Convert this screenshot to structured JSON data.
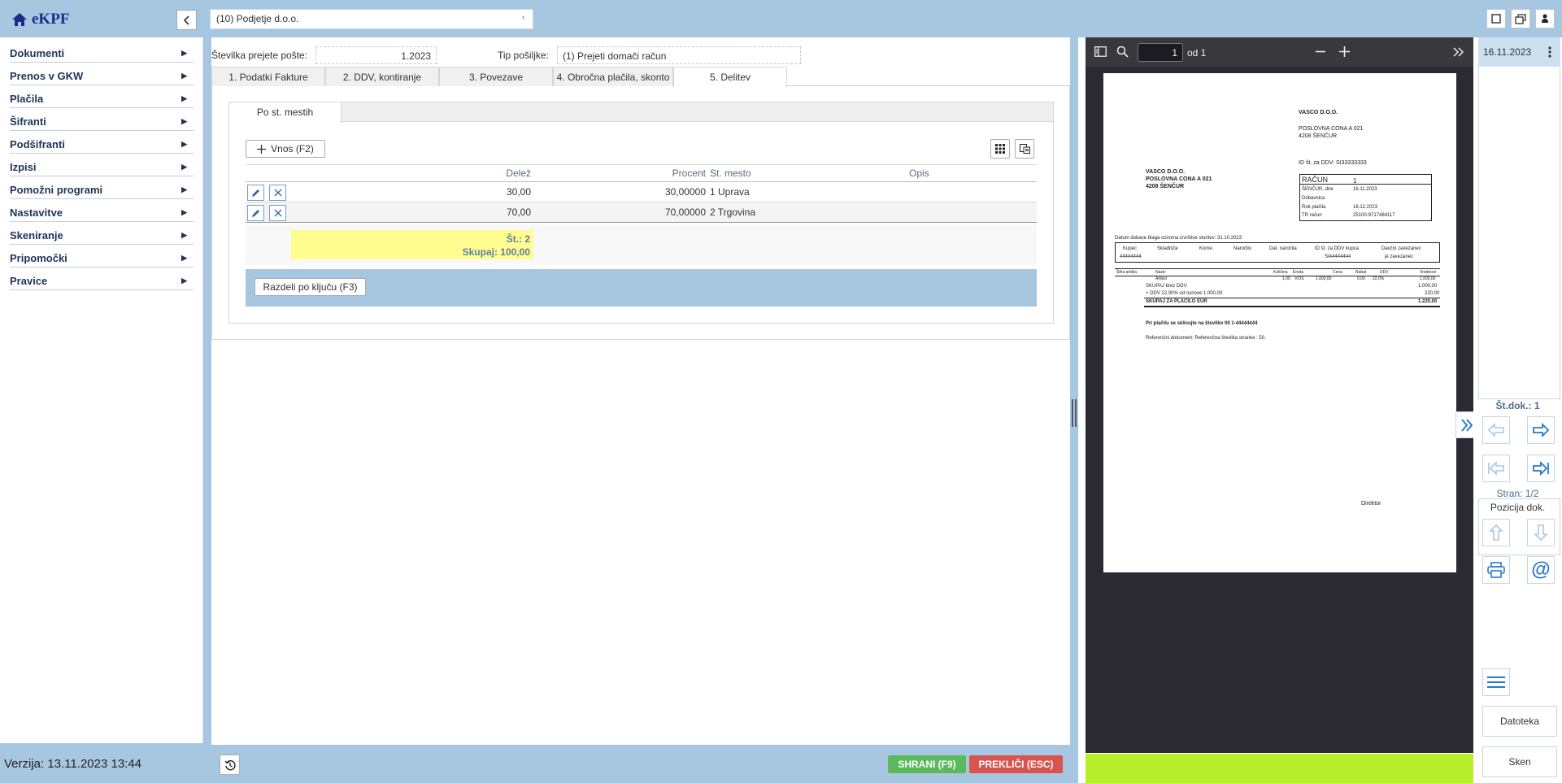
{
  "app": {
    "logo": "eKPF",
    "company": "(10) Podjetje d.o.o."
  },
  "sidebar": {
    "items": [
      {
        "label": "Dokumenti"
      },
      {
        "label": "Prenos v GKW"
      },
      {
        "label": "Plačila"
      },
      {
        "label": "Šifranti"
      },
      {
        "label": "Podšifranti"
      },
      {
        "label": "Izpisi"
      },
      {
        "label": "Pomožni programi"
      },
      {
        "label": "Nastavitve"
      },
      {
        "label": "Skeniranje"
      },
      {
        "label": "Pripomočki"
      },
      {
        "label": "Pravice"
      }
    ],
    "version": "Verzija: 13.11.2023 13:44"
  },
  "form": {
    "mail_no_label": "Številka prejete pošte:",
    "mail_no_value": "1.2023",
    "type_label": "Tip pošiljke:",
    "type_value": "(1) Prejeti domači račun"
  },
  "tabs": [
    {
      "label": "1. Podatki Fakture"
    },
    {
      "label": "2. DDV, kontiranje"
    },
    {
      "label": "3. Povezave"
    },
    {
      "label": "4. Obročna plačila, skonto"
    },
    {
      "label": "5. Delitev"
    }
  ],
  "inner_tab": "Po st. mestih",
  "toolbar": {
    "add_label": "Vnos (F2)"
  },
  "grid": {
    "columns": {
      "share": "Delež",
      "percent": "Procent",
      "cost_center": "St. mesto",
      "desc": "Opis"
    },
    "rows": [
      {
        "share": "30,00",
        "percent": "30,00000",
        "cost_center": "1 Uprava",
        "desc": ""
      },
      {
        "share": "70,00",
        "percent": "70,00000",
        "cost_center": "2 Trgovina",
        "desc": ""
      }
    ],
    "summary": {
      "count": "Št.: 2",
      "total": "Skupaj: 100,00"
    }
  },
  "split_button": "Razdeli po ključu (F3)",
  "actions": {
    "save": "SHRANI (F9)",
    "cancel": "PREKLIČI (ESC)"
  },
  "pdf": {
    "page_input": "1",
    "page_of": "od 1",
    "doc": {
      "seller_name": "VASCO D.O.O.",
      "seller_addr1": "POSLOVNA CONA A 021",
      "seller_addr2": "4208 ŠENČUR",
      "vat_id": "ID št. za DDV: SI33333333",
      "buyer_name": "VASCO D.O.O.",
      "buyer_addr1": "POSLOVNA CONA A 021",
      "buyer_addr2": "4208 ŠENČUR",
      "invoice_label": "RAČUN",
      "invoice_no": "1",
      "place_date_label": "ŠENČUR, dne",
      "place_date": "16.11.2023",
      "delivery_label": "Dobavnica",
      "due_label": "Rok plačila",
      "due_date": "18.12.2023",
      "tr_label": "TR račun",
      "tr_value": "25100-9717484117",
      "delivery_date": "Datum dobave blaga oziroma izvršitve storitev: 31.10.2023",
      "h_buyer": "Kupec",
      "h_buyer_val": "44444444",
      "h_warehouse": "Skladišče",
      "h_comm": "Kome.",
      "h_order": "Naročilo",
      "h_order_date": "Dat. naročila",
      "h_buyer_vat": "ID št. za DDV kupca",
      "h_buyer_vat_val": "SI44444444",
      "h_liable": "Davčni zavezanec",
      "h_liable_val": "je zavezanec",
      "c_code": "Šifra artikla",
      "c_name": "Naziv",
      "c_qty": "Količina",
      "c_unit": "Enota",
      "c_price": "Cena",
      "c_disc": "Rabat",
      "c_vat": "DDV",
      "c_value": "Vrednost",
      "item_name": "Artikel",
      "item_qty": "1,00",
      "item_unit": "KOS",
      "item_price": "1.000,00",
      "item_disc": "0,00",
      "item_vat": "22,0%",
      "item_value": "1.000,00",
      "sum_net_label": "SKUPAJ brez DDV",
      "sum_net": "1.000,00",
      "vat_line": "+ DDV 22,00% od osnove 1.000,00",
      "vat_value": "220,00",
      "total_label": "SKUPAJ ZA PLAČILO EUR",
      "total_value": "1.220,00",
      "pay_ref": "Pri plačilu se sklicujte na številko 00 1-44444444",
      "ref_doc": "Referenčni dokument: Referenčna številka stranke : 50.",
      "signature": "Direktor"
    }
  },
  "right": {
    "date": "16.11.2023",
    "doc_count": "Št.dok.: 1",
    "page": "Stran: 1/2",
    "doc_position": "Pozicija dok.",
    "file_btn": "Datoteka",
    "scan_btn": "Sken"
  }
}
